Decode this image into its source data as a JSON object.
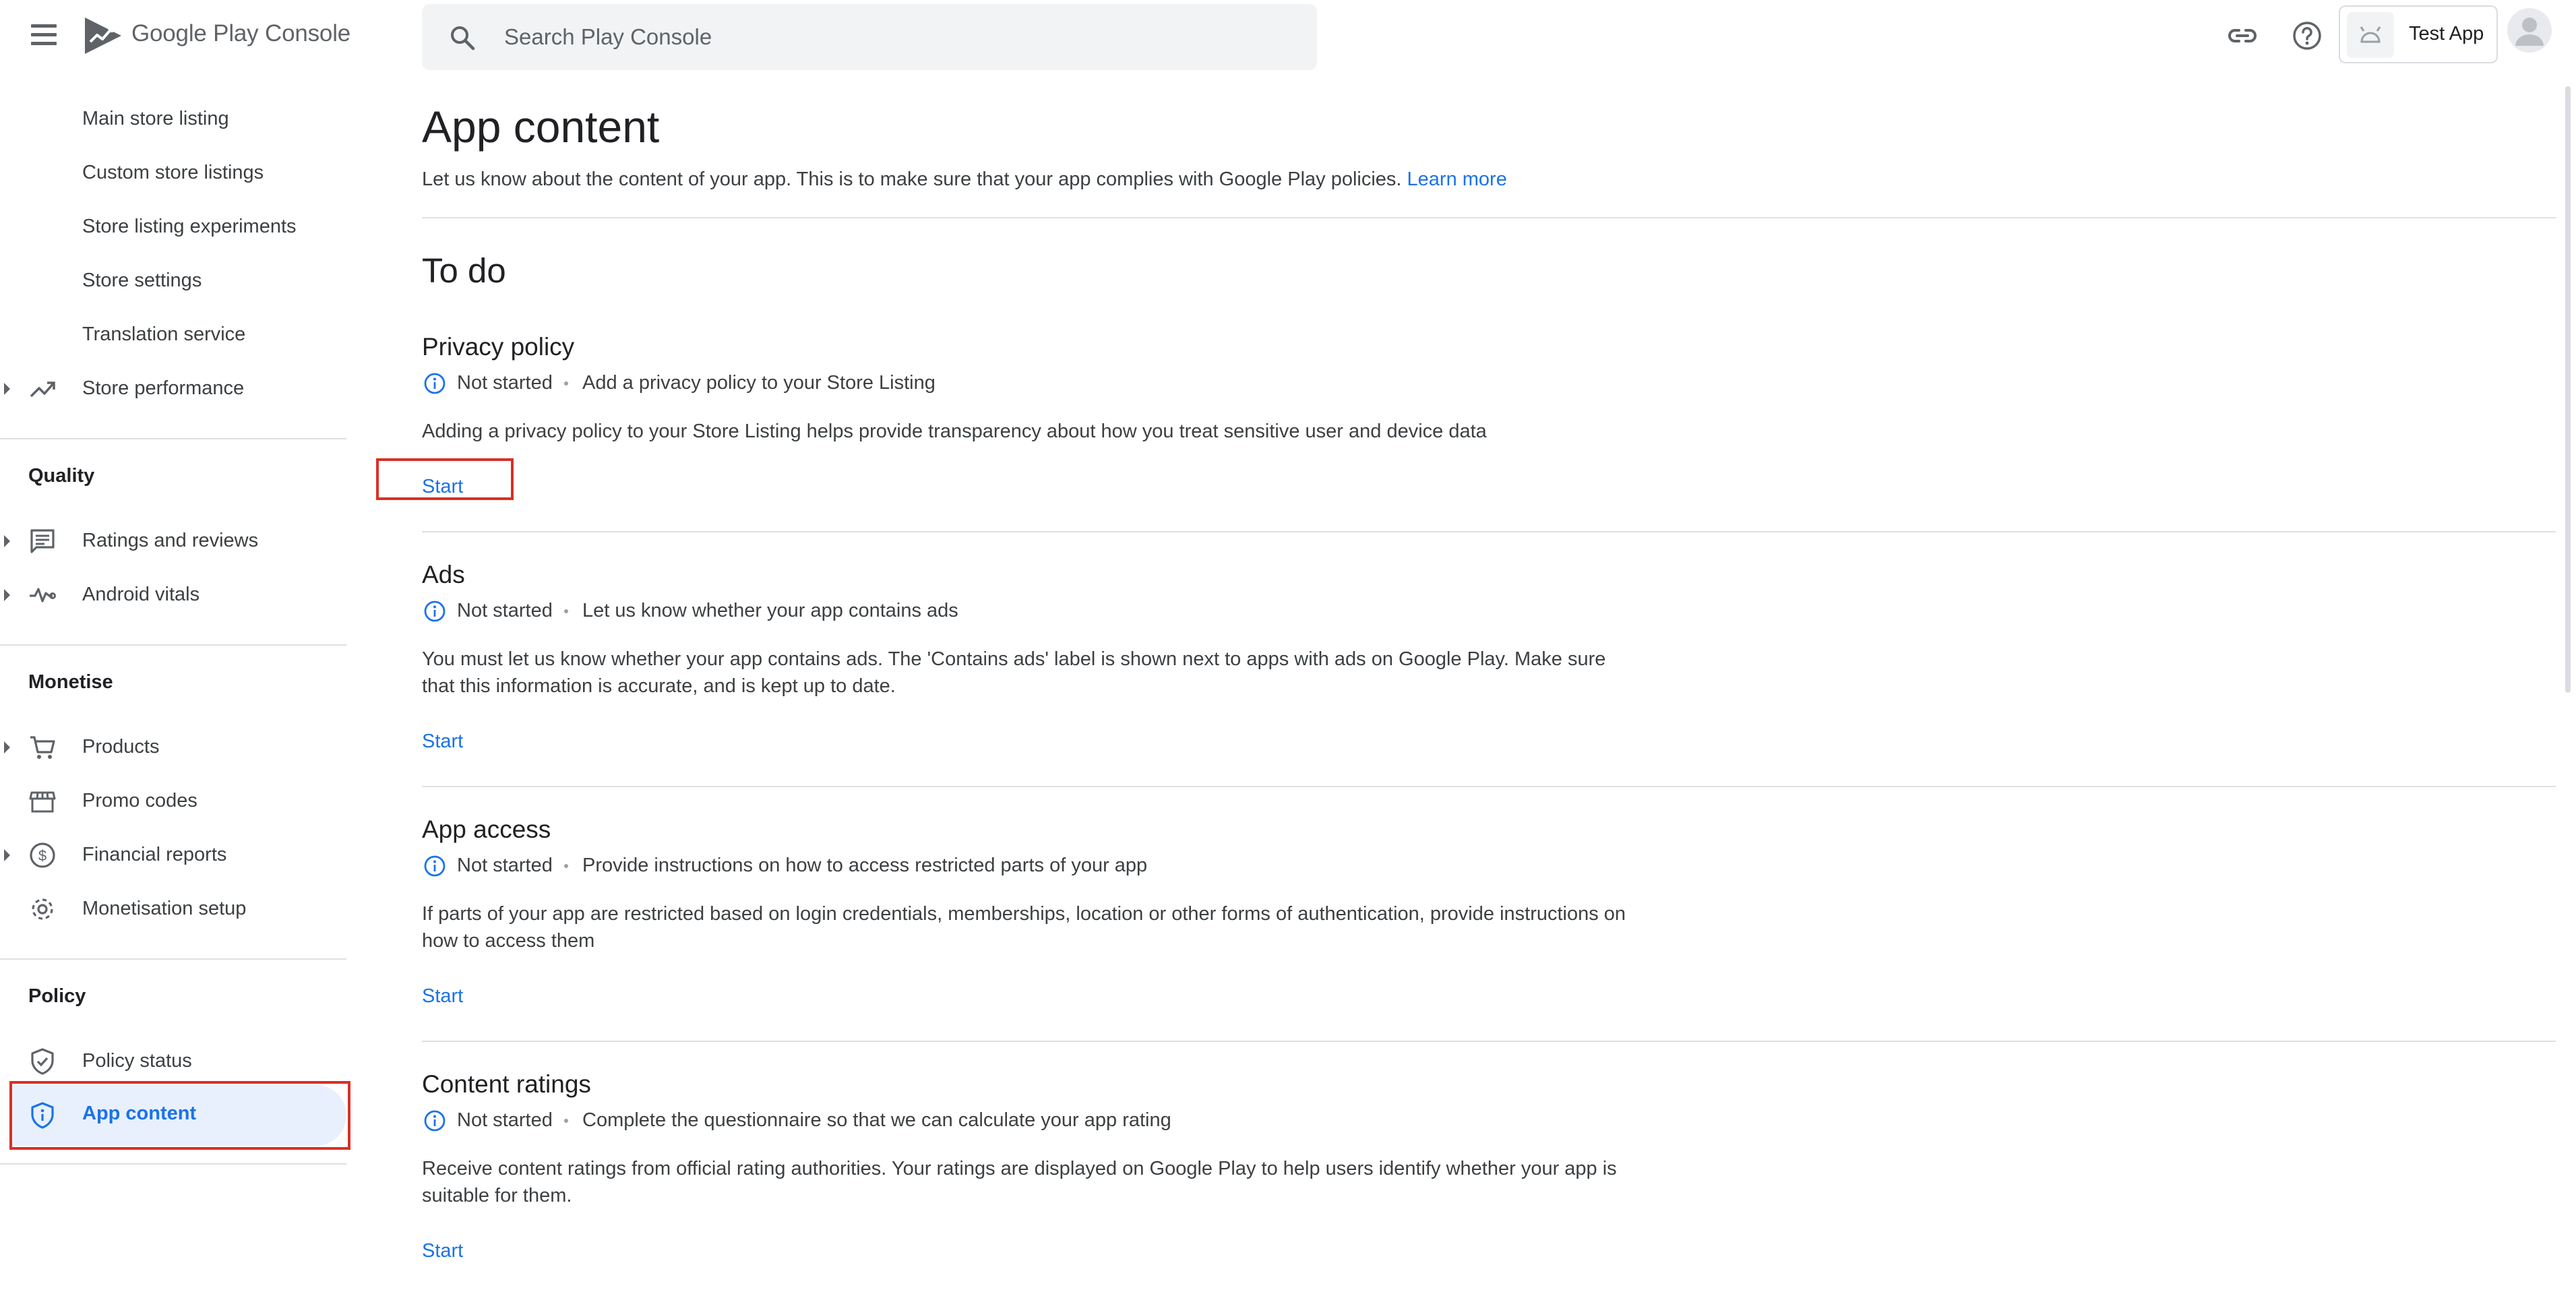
{
  "header": {
    "brand_google": "Google Play",
    "brand_console": "Console",
    "search_placeholder": "Search Play Console",
    "app_name": "Test App"
  },
  "sidebar": {
    "items": [
      {
        "label": "Main store listing"
      },
      {
        "label": "Custom store listings"
      },
      {
        "label": "Store listing experiments"
      },
      {
        "label": "Store settings"
      },
      {
        "label": "Translation service"
      },
      {
        "label": "Store performance"
      }
    ],
    "quality": {
      "heading": "Quality",
      "items": [
        {
          "label": "Ratings and reviews"
        },
        {
          "label": "Android vitals"
        }
      ]
    },
    "monetise": {
      "heading": "Monetise",
      "items": [
        {
          "label": "Products"
        },
        {
          "label": "Promo codes"
        },
        {
          "label": "Financial reports"
        },
        {
          "label": "Monetisation setup"
        }
      ]
    },
    "policy": {
      "heading": "Policy",
      "items": [
        {
          "label": "Policy status"
        },
        {
          "label": "App content"
        }
      ]
    }
  },
  "main": {
    "title": "App content",
    "intro": "Let us know about the content of your app. This is to make sure that your app complies with Google Play policies.",
    "learn_more": "Learn more",
    "todo_heading": "To do",
    "cards": [
      {
        "title": "Privacy policy",
        "status": "Not started",
        "summary": "Add a privacy policy to your Store Listing",
        "description": "Adding a privacy policy to your Store Listing helps provide transparency about how you treat sensitive user and device data",
        "action": "Start"
      },
      {
        "title": "Ads",
        "status": "Not started",
        "summary": "Let us know whether your app contains ads",
        "description": "You must let us know whether your app contains ads. The 'Contains ads' label is shown next to apps with ads on Google Play. Make sure that this information is accurate, and is kept up to date.",
        "action": "Start"
      },
      {
        "title": "App access",
        "status": "Not started",
        "summary": "Provide instructions on how to access restricted parts of your app",
        "description": "If parts of your app are restricted based on login credentials, memberships, location or other forms of authentication, provide instructions on how to access them",
        "action": "Start"
      },
      {
        "title": "Content ratings",
        "status": "Not started",
        "summary": "Complete the questionnaire so that we can calculate your app rating",
        "description": "Receive content ratings from official rating authorities. Your ratings are displayed on Google Play to help users identify whether your app is suitable for them.",
        "action": "Start"
      }
    ]
  },
  "colors": {
    "accent": "#1a73e8",
    "active_bg": "#e8f0fe",
    "highlight": "#d93025",
    "text_secondary": "#3c4043"
  }
}
